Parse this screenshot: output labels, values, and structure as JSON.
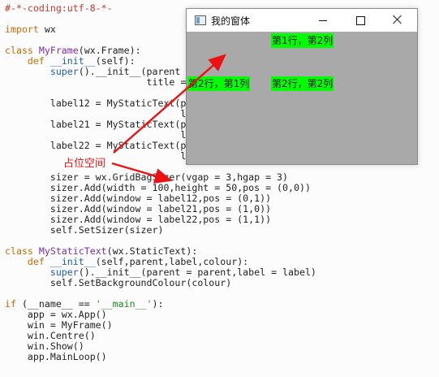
{
  "editor": {
    "lines": [
      "#-*-coding:utf-8-*-",
      "",
      "import wx",
      "",
      "class MyFrame(wx.Frame):",
      "    def __init__(self):",
      "        super().__init__(parent",
      "                         title =",
      "",
      "        label12 = MyStaticText(p",
      "                               l",
      "        label21 = MyStaticText(p",
      "                               l",
      "        label22 = MyStaticText(p",
      "                               l",
      "",
      "        sizer = wx.GridBagSizer(vgap = 3,hgap = 3)",
      "        sizer.Add(width = 100,height = 50,pos = (0,0))",
      "        sizer.Add(window = label12,pos = (0,1))",
      "        sizer.Add(window = label21,pos = (1,0))",
      "        sizer.Add(window = label22,pos = (1,1))",
      "        self.SetSizer(sizer)",
      "",
      "class MyStaticText(wx.StaticText):",
      "    def __init__(self,parent,label,colour):",
      "        super().__init__(parent = parent,label = label)",
      "        self.SetBackgroundColour(colour)",
      "",
      "if (__name__ == '__main__'):",
      "    app = wx.App()",
      "    win = MyFrame()",
      "    win.Centre()",
      "    win.Show()",
      "    app.MainLoop()"
    ]
  },
  "window": {
    "title": "我的窗体",
    "client_bg": "#a9a9a9",
    "labels": {
      "r1c2": "第1行，第2列",
      "r2c1": "第2行，第1列",
      "r2c2": "第2行，第2列"
    },
    "label_color": "#00ff00"
  },
  "annotation": {
    "text": "占位空间",
    "color": "#ee1111"
  },
  "icons": [
    "app-icon",
    "minimize-icon",
    "maximize-icon",
    "close-icon"
  ]
}
